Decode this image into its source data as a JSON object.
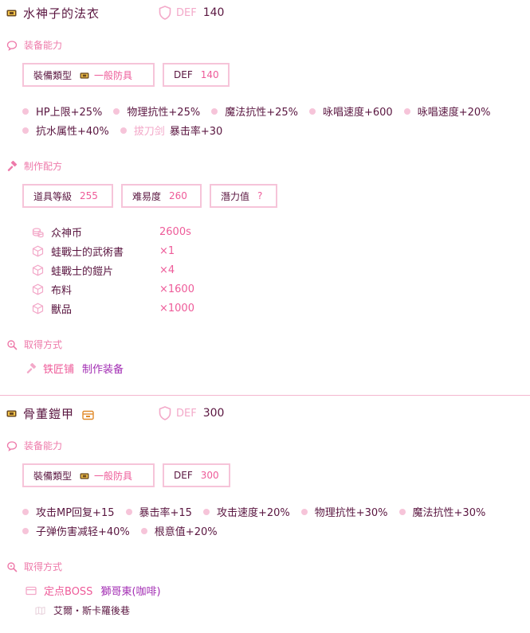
{
  "items": [
    {
      "name": "水神子的法衣",
      "def_label": "DEF",
      "def_value": "140",
      "ability_heading": "装备能力",
      "type_label": "裝備類型",
      "type_value": "一般防具",
      "def_box_label": "DEF",
      "def_box_value": "140",
      "stats_line1": [
        "HP上限+25%",
        "物理抗性+25%",
        "魔法抗性+25%",
        "咏唱速度+600",
        "咏唱速度+20%"
      ],
      "stats_line2_a": "抗水属性+40%",
      "stats_line2_b_prefix": "拔刀剑",
      "stats_line2_b": "暴击率+30",
      "craft_heading": "制作配方",
      "craft_level_label": "道具等級",
      "craft_level_value": "255",
      "difficulty_label": "难易度",
      "difficulty_value": "260",
      "potential_label": "潛力值",
      "potential_value": "?",
      "materials": [
        {
          "name": "众神币",
          "qty": "2600s",
          "icon": "coins-icon"
        },
        {
          "name": "蛙戰士的武術書",
          "qty": "×1",
          "icon": "box-icon"
        },
        {
          "name": "蛙戰士的鎧片",
          "qty": "×4",
          "icon": "box-icon"
        },
        {
          "name": "布料",
          "qty": "×1600",
          "icon": "box-icon"
        },
        {
          "name": "獸品",
          "qty": "×1000",
          "icon": "box-icon"
        }
      ],
      "obtain_heading": "取得方式",
      "obtain_source": "铁匠铺",
      "obtain_method": "制作装备"
    },
    {
      "name": "骨董鎧甲",
      "def_label": "DEF",
      "def_value": "300",
      "ability_heading": "装备能力",
      "type_label": "裝備類型",
      "type_value": "一般防具",
      "def_box_label": "DEF",
      "def_box_value": "300",
      "stats_line1": [
        "攻击MP回复+15",
        "暴击率+15",
        "攻击速度+20%",
        "物理抗性+30%",
        "魔法抗性+30%"
      ],
      "stats_line2": [
        "子弹伤害减轻+40%",
        "根意值+20%"
      ],
      "obtain_heading": "取得方式",
      "obtain_type": "定点BOSS",
      "boss_name": "獅哥東(咖啡)",
      "boss_location": "艾爾・斯卡羅後巷"
    }
  ],
  "colors": {
    "accent": "#ee5b99",
    "heading": "#ee7aaa",
    "border": "#f6c4d9",
    "text": "#5a1640",
    "link_purple": "#a32fb4"
  }
}
